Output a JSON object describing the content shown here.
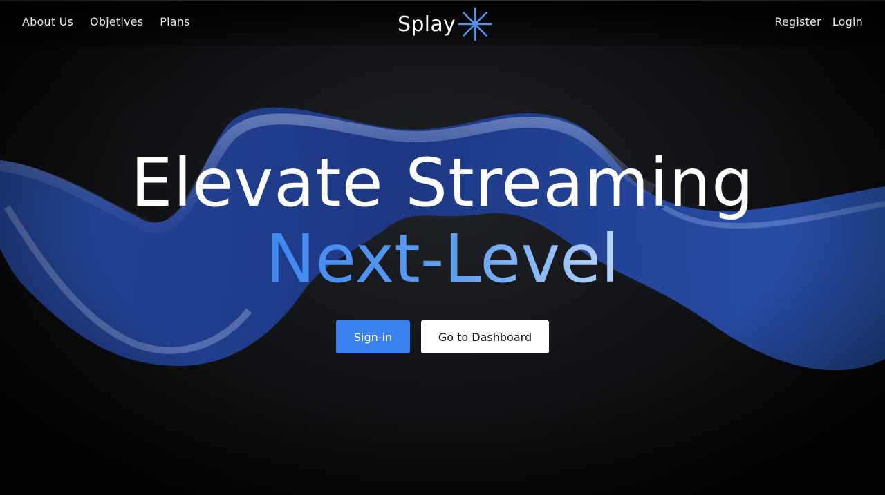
{
  "nav": {
    "left_links": [
      {
        "label": "About Us"
      },
      {
        "label": "Objetives"
      },
      {
        "label": "Plans"
      }
    ],
    "right_links": [
      {
        "label": "Register"
      },
      {
        "label": "Login"
      }
    ]
  },
  "brand": {
    "name": "Splay",
    "icon": "asterisk-star-icon",
    "accent_color": "#3f86ef"
  },
  "hero": {
    "line1": "Elevate Streaming",
    "line2": "Next-Level"
  },
  "actions": {
    "primary_label": "Sign-in",
    "secondary_label": "Go to Dashboard"
  },
  "colors": {
    "background": "#050505",
    "primary_button": "#3a82ee",
    "secondary_button": "#ffffff"
  }
}
